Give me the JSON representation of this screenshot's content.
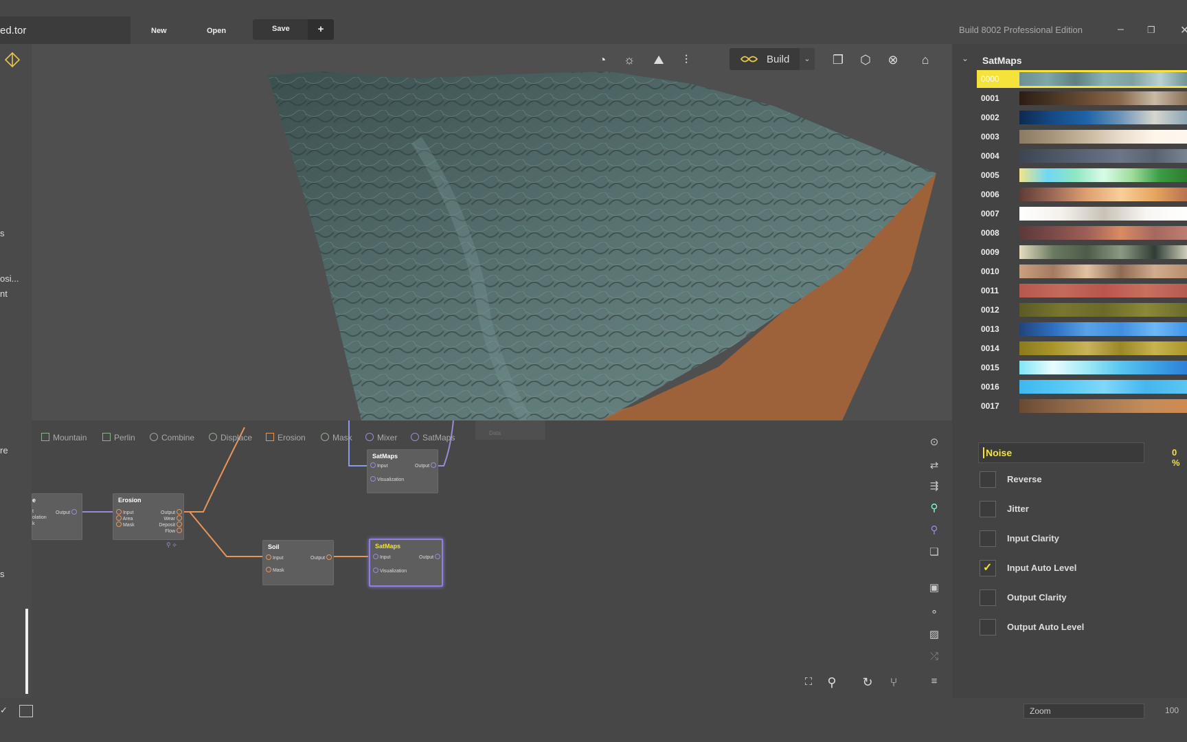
{
  "titlebar": {
    "file_tab": "ed.tor",
    "new": "New",
    "open": "Open",
    "save": "Save",
    "add": "+",
    "build_info": "Build 8002 Professional Edition"
  },
  "left_cut_labels": [
    "s",
    "osi...",
    "nt",
    "re",
    "s"
  ],
  "viewport": {
    "build_label": "Build"
  },
  "graph": {
    "chips": [
      {
        "label": "Mountain",
        "color": "#8fb08f"
      },
      {
        "label": "Perlin",
        "color": "#8fb08f"
      },
      {
        "label": "Combine",
        "color": "#aaaaaa"
      },
      {
        "label": "Displace",
        "color": "#aaaaaa"
      },
      {
        "label": "Erosion",
        "color": "#e8955a"
      },
      {
        "label": "Mask",
        "color": "#aaaaaa"
      },
      {
        "label": "Mixer",
        "color": "#9a8bd8"
      },
      {
        "label": "SatMaps",
        "color": "#9a8bd8"
      }
    ],
    "ghost_node": "Data",
    "nodes": {
      "partial": {
        "title": "e",
        "ports_left": [
          "t",
          "olation",
          "k"
        ],
        "output": "Output"
      },
      "erosion": {
        "title": "Erosion",
        "inputs": [
          "Input",
          "Area",
          "Mask"
        ],
        "outputs": [
          "Output",
          "Wear",
          "Deposit",
          "Flow"
        ]
      },
      "satmaps_top": {
        "title": "SatMaps",
        "inputs": [
          "Input",
          "Visualization"
        ],
        "output": "Output"
      },
      "soil": {
        "title": "Soil",
        "inputs": [
          "Input",
          "Mask"
        ],
        "output": "Output"
      },
      "satmaps_sel": {
        "title": "SatMaps",
        "inputs": [
          "Input",
          "Visualization"
        ],
        "output": "Output"
      }
    }
  },
  "panel": {
    "title": "SatMaps",
    "maps": [
      {
        "id": "0000",
        "grad": "linear-gradient(90deg,#6d8f91,#7fa6a8,#5f7f82,#8ab3b4,#7fa0a2,#b9d1d2,#6e9092)"
      },
      {
        "id": "0001",
        "grad": "linear-gradient(90deg,#2b1d14,#4a3526,#6b4c33,#8a6a4e,#c9b9a6,#8a6e55)"
      },
      {
        "id": "0002",
        "grad": "linear-gradient(90deg,#0e2a4f,#164a86,#1e64a8,#6d95b9,#d6d6cf,#8aa4b5)"
      },
      {
        "id": "0003",
        "grad": "linear-gradient(90deg,#8b7a64,#a8957c,#c9b8a0,#e9ddcc,#fff6ea,#fdf7ef)"
      },
      {
        "id": "0004",
        "grad": "linear-gradient(90deg,#3d4553,#4b5564,#5b6575,#6c7686,#59626f,#7a8494)"
      },
      {
        "id": "0005",
        "grad": "linear-gradient(90deg,#f2e48a,#6fd8f2,#8fe7c4,#d9fbe7,#9fdc9a,#3c9b44,#2f7a2f)"
      },
      {
        "id": "0006",
        "grad": "linear-gradient(90deg,#5e3d34,#9c6a57,#e0a071,#f7cf98,#e8a55d,#b7704f)"
      },
      {
        "id": "0007",
        "grad": "linear-gradient(90deg,#ffffff,#f4f1ec,#c9c2b7,#f8f6f2,#ffffff)"
      },
      {
        "id": "0008",
        "grad": "linear-gradient(90deg,#5a3a3a,#7a4b48,#9e5f56,#d98b63,#a5685e,#bd7f70)"
      },
      {
        "id": "0009",
        "grad": "linear-gradient(90deg,#e6ddc0,#6a7a60,#4d5c4a,#8c9a83,#2f3d36,#d6d3bf)"
      },
      {
        "id": "0010",
        "grad": "linear-gradient(90deg,#c9a07f,#a57a5f,#e2c2a2,#8e6a52,#d0ad8d,#b88d6c)"
      },
      {
        "id": "0011",
        "grad": "linear-gradient(90deg,#b7584d,#c46a5c,#b9564c,#c9705f,#b55a4f)"
      },
      {
        "id": "0012",
        "grad": "linear-gradient(90deg,#5b5a25,#7a7630,#6b6a2a,#8c8838,#6a6a2c)"
      },
      {
        "id": "0013",
        "grad": "linear-gradient(90deg,#22447a,#2f6fbf,#59a3e6,#3f8fe0,#6fb8f5,#3f95ea)"
      },
      {
        "id": "0014",
        "grad": "linear-gradient(90deg,#8a7a1e,#a8962a,#c9b45a,#9a8726,#c7b44e,#a99528)"
      },
      {
        "id": "0015",
        "grad": "linear-gradient(90deg,#7fe7f7,#eafcff,#9fe9f6,#57c6ef,#3ca3e6,#2f7fd8)"
      },
      {
        "id": "0016",
        "grad": "linear-gradient(90deg,#3fb8f0,#56c8f5,#7fd8f8,#46b6ef,#5cc6f3)"
      },
      {
        "id": "0017",
        "grad": "linear-gradient(90deg,#6a4a32,#8c6446,#a87a52,#c48c5a,#d08a4e)"
      }
    ],
    "selected_map": "0000",
    "noise_label": "Noise",
    "noise_value": "0 %",
    "options": [
      {
        "label": "Reverse",
        "checked": false
      },
      {
        "label": "Jitter",
        "checked": false
      },
      {
        "label": "Input Clarity",
        "checked": false
      },
      {
        "label": "Input Auto Level",
        "checked": true
      },
      {
        "label": "Output Clarity",
        "checked": false
      },
      {
        "label": "Output Auto Level",
        "checked": false
      }
    ]
  },
  "bottombar": {
    "zoom_label": "Zoom",
    "zoom_value": "100"
  },
  "colors": {
    "accent": "#f5e23a",
    "erosion_wire": "#e8955a",
    "satmap_wire": "#9a8bd8",
    "terrain_top": "#4f6b6c",
    "terrain_side": "#a0643a"
  }
}
